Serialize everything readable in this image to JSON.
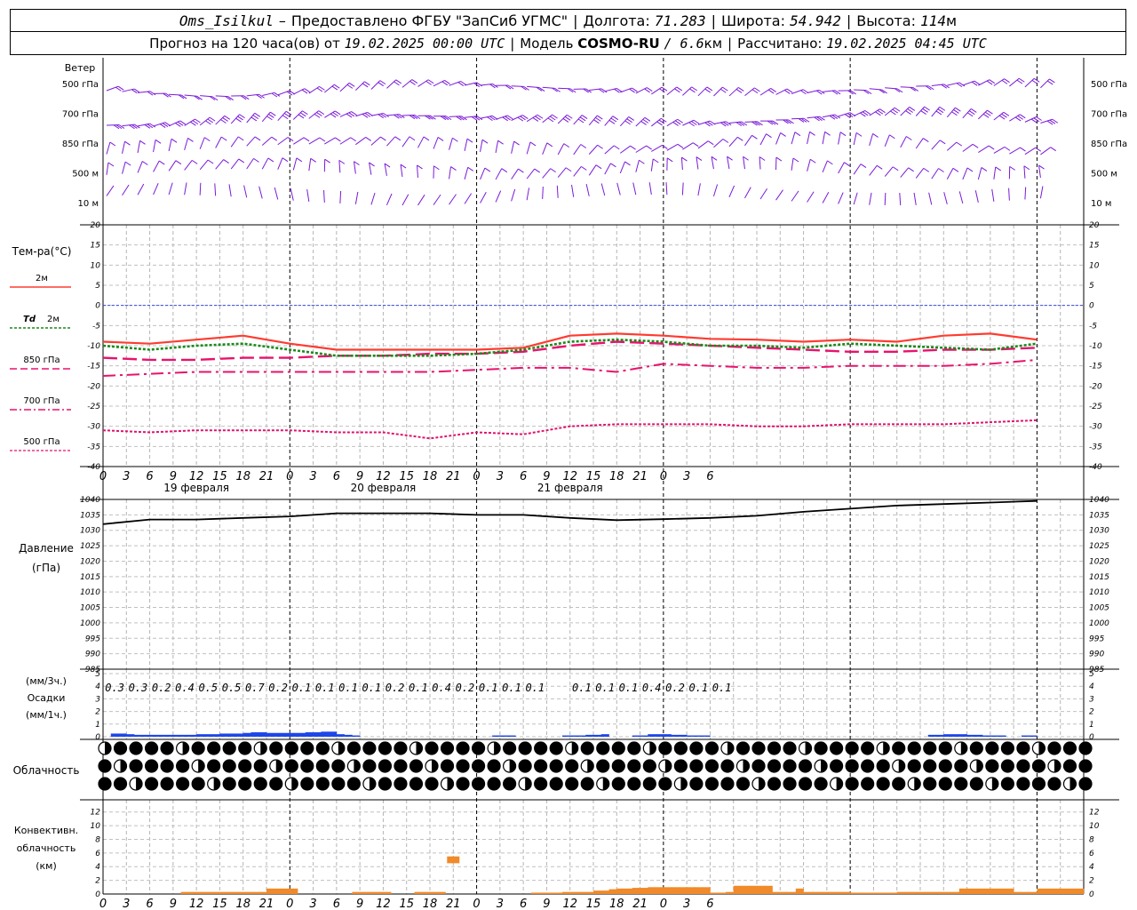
{
  "header": {
    "station": "Oms_Isilkul",
    "dash": "–",
    "provided": "Предоставлено ФГБУ \"ЗапСиб УГМС\"",
    "lon_label": "Долгота:",
    "lon": "71.283",
    "lat_label": "Широта:",
    "lat": "54.942",
    "alt_label": "Высота:",
    "alt": "114",
    "alt_unit": "м",
    "forecast_label": "Прогноз на 120 часа(ов) от",
    "forecast_from": "19.02.2025 00:00 UTC",
    "model_label": "Модель",
    "model": "COSMO-RU",
    "model_res": "/ 6.6",
    "model_res_unit": "км",
    "calc_label": "Рассчитано:",
    "calc_time": "19.02.2025 04:45 UTC"
  },
  "colors": {
    "t2m": "#ff3b30",
    "td2m": "#1a8a1a",
    "t850": "#e8126e",
    "t700": "#e8126e",
    "t500": "#e0126e",
    "zero_line": "#3a4be0",
    "wind": "#7a1ad8",
    "precip": "#1e46e8",
    "convective": "#f08a2a"
  },
  "labels": {
    "wind": "Ветер",
    "temperature": "Тем-ра(°C)",
    "t2m": "2м",
    "td": "Td",
    "td2m": "2м",
    "t850": "850 гПа",
    "t700": "700 гПа",
    "t500": "500 гПа",
    "pressure_1": "Давление",
    "pressure_2": "(гПа)",
    "precip_1": "(мм/3ч.)",
    "precip_2": "Осадки",
    "precip_3": "(мм/1ч.)",
    "cloud": "Облачность",
    "conv_1": "Конвективн.",
    "conv_2": "облачность",
    "conv_3": "(км)"
  },
  "wind_levels": [
    "500 гПа",
    "700 гПа",
    "850 гПа",
    "500 м",
    "10 м"
  ],
  "x_ticks": [
    "0",
    "3",
    "6",
    "9",
    "12",
    "15",
    "18",
    "21",
    "0",
    "3",
    "6",
    "9",
    "12",
    "15",
    "18",
    "21",
    "0",
    "3",
    "6",
    "9",
    "12",
    "15",
    "18",
    "21",
    "0",
    "3",
    "6"
  ],
  "day_labels": [
    "19 февраля",
    "20 февраля",
    "21 февраля"
  ],
  "chart_data": [
    {
      "type": "line",
      "name": "temperature",
      "title": "Тем-ра(°C)",
      "ylim": [
        -40,
        20
      ],
      "yticks": [
        20,
        15,
        10,
        5,
        0,
        -5,
        -10,
        -15,
        -20,
        -25,
        -30,
        -35,
        -40
      ],
      "x_hours": [
        0,
        6,
        12,
        18,
        24,
        30,
        36,
        42,
        48,
        54,
        60,
        66,
        72,
        78,
        84,
        90,
        96,
        102,
        108,
        114,
        120
      ],
      "series": [
        {
          "name": "2м",
          "values": [
            -9,
            -9.5,
            -8.5,
            -7.5,
            -9.5,
            -11,
            -11,
            -11,
            -11,
            -10.5,
            -7.5,
            -7,
            -7.5,
            -8.3,
            -8.5,
            -9,
            -8.5,
            -9,
            -7.5,
            -7,
            -8.5
          ]
        },
        {
          "name": "Td 2м",
          "values": [
            -10,
            -11,
            -10,
            -9.5,
            -11,
            -12.5,
            -12.5,
            -12.5,
            -12,
            -11,
            -9,
            -8.5,
            -9,
            -10,
            -10,
            -10.5,
            -9.5,
            -10,
            -10.5,
            -11,
            -9.5
          ]
        },
        {
          "name": "850 гПа",
          "values": [
            -13,
            -13.5,
            -13.5,
            -13,
            -13,
            -12.5,
            -12.5,
            -12,
            -12,
            -11.5,
            -10,
            -9,
            -9.5,
            -10,
            -10.5,
            -11,
            -11.5,
            -11.5,
            -11,
            -11,
            -10.5
          ]
        },
        {
          "name": "700 гПа",
          "values": [
            -17.5,
            -17,
            -16.5,
            -16.5,
            -16.5,
            -16.5,
            -16.5,
            -16.5,
            -16,
            -15.5,
            -15.5,
            -16.5,
            -14.5,
            -15,
            -15.5,
            -15.5,
            -15,
            -15,
            -15,
            -14.5,
            -13.5
          ]
        },
        {
          "name": "500 гПа",
          "values": [
            -31,
            -31.5,
            -31,
            -31,
            -31,
            -31.5,
            -31.5,
            -33,
            -31.5,
            -32,
            -30,
            -29.5,
            -29.5,
            -29.5,
            -30,
            -30,
            -29.5,
            -29.5,
            -29.5,
            -29,
            -28.5
          ]
        }
      ]
    },
    {
      "type": "line",
      "name": "pressure",
      "title": "Давление (гПа)",
      "ylim": [
        985,
        1040
      ],
      "yticks": [
        1040,
        1035,
        1030,
        1025,
        1020,
        1015,
        1010,
        1005,
        1000,
        995,
        990,
        985
      ],
      "x_hours": [
        0,
        6,
        12,
        18,
        24,
        30,
        36,
        42,
        48,
        54,
        60,
        66,
        72,
        78,
        84,
        90,
        96,
        102,
        108,
        114,
        120
      ],
      "series": [
        {
          "name": "Давление",
          "values": [
            1032,
            1033.5,
            1033.5,
            1034,
            1034.5,
            1035.5,
            1035.5,
            1035.5,
            1035,
            1035,
            1034,
            1033.3,
            1033.6,
            1034,
            1034.7,
            1036,
            1037,
            1038,
            1038.5,
            1039,
            1039.5
          ]
        }
      ]
    },
    {
      "type": "bar",
      "name": "precipitation",
      "title": "Осадки",
      "ylim": [
        0,
        5
      ],
      "yticks": [
        5,
        4,
        3,
        2,
        1,
        0
      ],
      "x_hours_3h": [
        1.5,
        4.5,
        7.5,
        10.5,
        13.5,
        16.5,
        19.5,
        22.5,
        25.5,
        28.5,
        31.5,
        34.5,
        37.5,
        40.5,
        43.5,
        46.5,
        49.5,
        52.5,
        55.5,
        61.5,
        64.5,
        67.5,
        70.5,
        73.5,
        76.5,
        79.5
      ],
      "labels_3h": [
        "0.3",
        "0.3",
        "0.2",
        "0.4",
        "0.5",
        "0.5",
        "0.7",
        "0.2",
        "0.1",
        "0.1",
        "0.1",
        "0.1",
        "0.2",
        "0.1",
        "0.4",
        "0.2",
        "0.1",
        "0.1",
        "0.1",
        "0.1",
        "0.1",
        "0.1",
        "0.4",
        "0.2",
        "0.1",
        "0.1"
      ],
      "hourly": [
        0,
        0.25,
        0.25,
        0.2,
        0.15,
        0.15,
        0.15,
        0.15,
        0.15,
        0.15,
        0.15,
        0.15,
        0.2,
        0.2,
        0.2,
        0.25,
        0.25,
        0.25,
        0.3,
        0.35,
        0.35,
        0.3,
        0.3,
        0.3,
        0.3,
        0.3,
        0.35,
        0.35,
        0.4,
        0.4,
        0.2,
        0.15,
        0.1,
        0,
        0,
        0,
        0,
        0,
        0,
        0,
        0,
        0,
        0,
        0,
        0,
        0,
        0,
        0,
        0,
        0,
        0.1,
        0.1,
        0.1,
        0,
        0,
        0,
        0,
        0,
        0,
        0.1,
        0.1,
        0.1,
        0.15,
        0.15,
        0.2,
        0,
        0,
        0,
        0.1,
        0.1,
        0.2,
        0.2,
        0.2,
        0.15,
        0.15,
        0.1,
        0.1,
        0.1,
        0,
        0,
        0,
        0,
        0,
        0,
        0,
        0,
        0,
        0,
        0,
        0,
        0,
        0,
        0,
        0,
        0,
        0,
        0,
        0,
        0,
        0,
        0,
        0,
        0,
        0,
        0,
        0,
        0.15,
        0.15,
        0.2,
        0.2,
        0.2,
        0.15,
        0.15,
        0.1,
        0.1,
        0.1,
        0,
        0,
        0.1,
        0.1,
        0
      ]
    },
    {
      "type": "bar",
      "name": "convective_cloud",
      "title": "Конвективн. облачность (км)",
      "ylim": [
        0,
        13
      ],
      "yticks": [
        12,
        10,
        8,
        6,
        4,
        2,
        0
      ],
      "isolated_top_hour": 45,
      "isolated_top_km": [
        4.5,
        5.5
      ],
      "hourly_top_km": [
        0,
        0,
        0,
        0,
        0,
        0,
        0,
        0,
        0,
        0,
        0.3,
        0.3,
        0.3,
        0.3,
        0.3,
        0.3,
        0.3,
        0.3,
        0.3,
        0.3,
        0.3,
        0.8,
        0.8,
        0.8,
        0.8,
        0,
        0,
        0,
        0,
        0,
        0,
        0,
        0.3,
        0.3,
        0.3,
        0.3,
        0.3,
        0,
        0,
        0,
        0.3,
        0.3,
        0.3,
        0.3,
        0,
        0,
        0,
        0,
        0,
        0,
        0,
        0,
        0,
        0,
        0,
        0.2,
        0.2,
        0.2,
        0.2,
        0.3,
        0.3,
        0.3,
        0.3,
        0.5,
        0.5,
        0.7,
        0.8,
        0.8,
        0.9,
        0.9,
        1.0,
        1.0,
        1.0,
        1.0,
        1.0,
        1.0,
        1.0,
        1.0,
        0.2,
        0.2,
        0.3,
        1.2,
        1.2,
        1.2,
        1.2,
        1.2,
        0.3,
        0.3,
        0.3,
        0.8,
        0.3,
        0.3,
        0.3,
        0.3,
        0.3,
        0.3,
        0.2,
        0.2,
        0.2,
        0.2,
        0.2,
        0.2,
        0.3,
        0.3,
        0.3,
        0.3,
        0.3,
        0.3,
        0.3,
        0.3,
        0.8,
        0.8,
        0.8,
        0.8,
        0.8,
        0.8,
        0.8,
        0.3,
        0.3,
        0.3,
        0.8
      ],
      "hourly_top_km_tail": [
        0.8,
        0.8,
        0.8,
        0.8,
        0.8,
        0.8,
        0.8,
        0.8,
        0.3,
        0.3,
        0.3,
        0.5,
        0.5,
        0.2,
        0.2,
        0.2,
        0.2,
        0.2,
        0.2,
        0.2,
        0.2,
        0.2,
        0.2,
        0.2,
        0.2,
        0.2,
        0.2,
        0.2,
        0.2,
        0.2,
        0.2,
        0.2,
        0.2,
        0.2,
        0.2,
        0.2,
        0.2,
        0.2,
        0.3
      ]
    }
  ]
}
